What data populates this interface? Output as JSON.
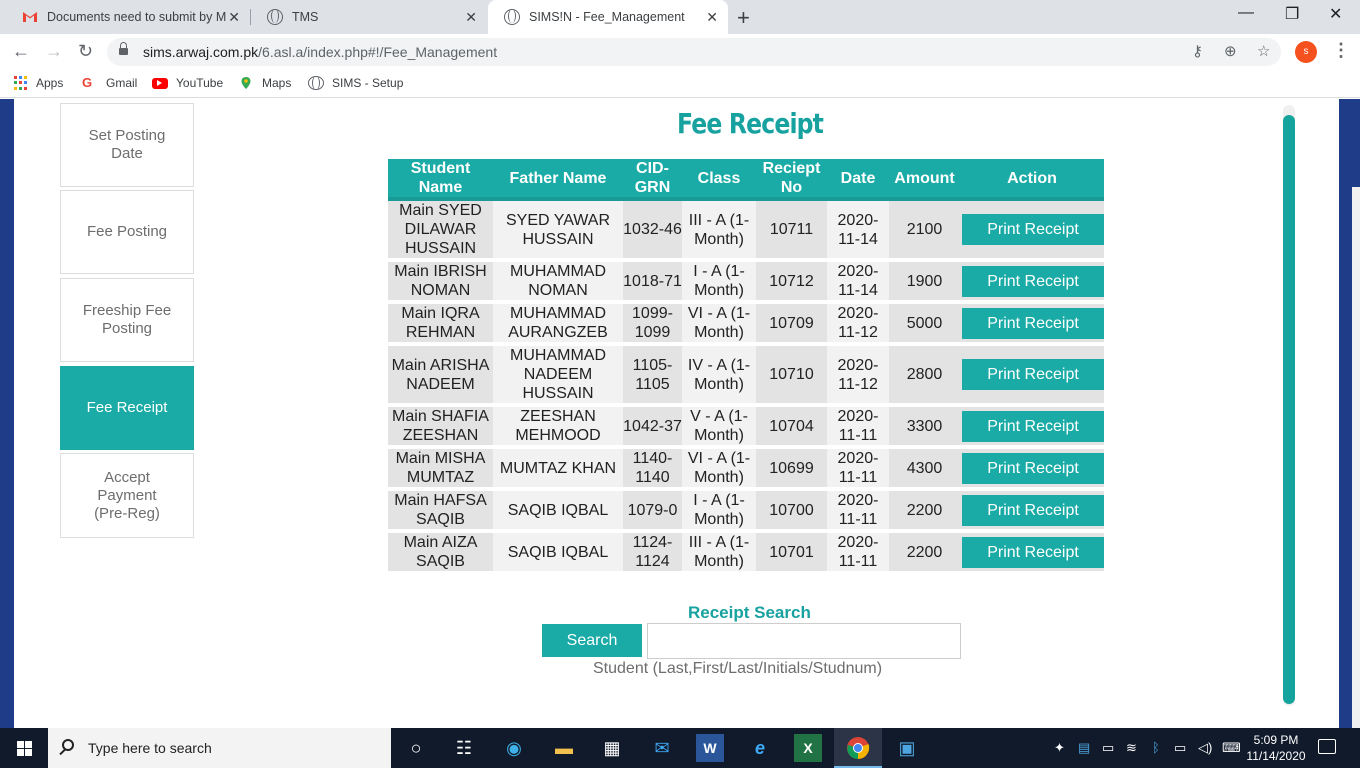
{
  "browser": {
    "tabs": [
      {
        "title": "Documents need to submit by M",
        "icon": "gmail-icon"
      },
      {
        "title": "TMS",
        "icon": "globe-icon"
      },
      {
        "title": "SIMS!N - Fee_Management",
        "icon": "globe-icon",
        "active": true
      }
    ],
    "url_host": "sims.arwaj.com.pk",
    "url_path": "/6.asl.a/index.php#!/Fee_Management",
    "profile_initial": "s",
    "bookmarks": [
      "Apps",
      "Gmail",
      "YouTube",
      "Maps",
      "SIMS - Setup"
    ]
  },
  "sidebar": {
    "items": [
      {
        "label": "Set Posting Date"
      },
      {
        "label": "Fee Posting"
      },
      {
        "label": "Freeship Fee Posting"
      },
      {
        "label": "Fee Receipt",
        "active": true
      },
      {
        "label": "Accept Payment (Pre-Reg)"
      }
    ]
  },
  "main": {
    "title": "Fee Receipt",
    "table": {
      "headers": [
        "Student Name",
        "Father Name",
        "CID-GRN",
        "Class",
        "Reciept No",
        "Date",
        "Amount",
        "Action"
      ],
      "rows": [
        {
          "student": "Main SYED DILAWAR HUSSAIN",
          "father": "SYED YAWAR HUSSAIN",
          "cid": "1032-46",
          "class": "III - A (1-Month)",
          "receipt": "10711",
          "date": "2020-11-14",
          "amount": "2100",
          "action": "Print Receipt"
        },
        {
          "student": "Main IBRISH NOMAN",
          "father": "MUHAMMAD NOMAN",
          "cid": "1018-71",
          "class": "I - A (1-Month)",
          "receipt": "10712",
          "date": "2020-11-14",
          "amount": "1900",
          "action": "Print Receipt"
        },
        {
          "student": "Main IQRA REHMAN",
          "father": "MUHAMMAD AURANGZEB",
          "cid": "1099-1099",
          "class": "VI - A (1-Month)",
          "receipt": "10709",
          "date": "2020-11-12",
          "amount": "5000",
          "action": "Print Receipt"
        },
        {
          "student": "Main ARISHA NADEEM",
          "father": "MUHAMMAD NADEEM HUSSAIN",
          "cid": "1105-1105",
          "class": "IV - A (1-Month)",
          "receipt": "10710",
          "date": "2020-11-12",
          "amount": "2800",
          "action": "Print Receipt"
        },
        {
          "student": "Main SHAFIA ZEESHAN",
          "father": "ZEESHAN MEHMOOD",
          "cid": "1042-37",
          "class": "V - A (1-Month)",
          "receipt": "10704",
          "date": "2020-11-11",
          "amount": "3300",
          "action": "Print Receipt"
        },
        {
          "student": "Main MISHA MUMTAZ",
          "father": "MUMTAZ KHAN",
          "cid": "1140-1140",
          "class": "VI - A (1-Month)",
          "receipt": "10699",
          "date": "2020-11-11",
          "amount": "4300",
          "action": "Print Receipt"
        },
        {
          "student": "Main HAFSA SAQIB",
          "father": "SAQIB IQBAL",
          "cid": "1079-0",
          "class": "I - A (1-Month)",
          "receipt": "10700",
          "date": "2020-11-11",
          "amount": "2200",
          "action": "Print Receipt"
        },
        {
          "student": "Main AIZA SAQIB",
          "father": "SAQIB IQBAL",
          "cid": "1124-1124",
          "class": "III - A (1-Month)",
          "receipt": "10701",
          "date": "2020-11-11",
          "amount": "2200",
          "action": "Print Receipt"
        }
      ]
    },
    "search": {
      "title": "Receipt Search",
      "button_label": "Search",
      "value": "",
      "hint": "Student (Last,First/Last/Initials/Studnum)"
    }
  },
  "taskbar": {
    "search_placeholder": "Type here to search",
    "time": "5:09 PM",
    "date": "11/14/2020"
  },
  "colors": {
    "accent": "#1aaba6",
    "frame": "#1f3c88",
    "row_bg": "#e3e3e3",
    "row_alt_bg": "#f2f2f2"
  }
}
